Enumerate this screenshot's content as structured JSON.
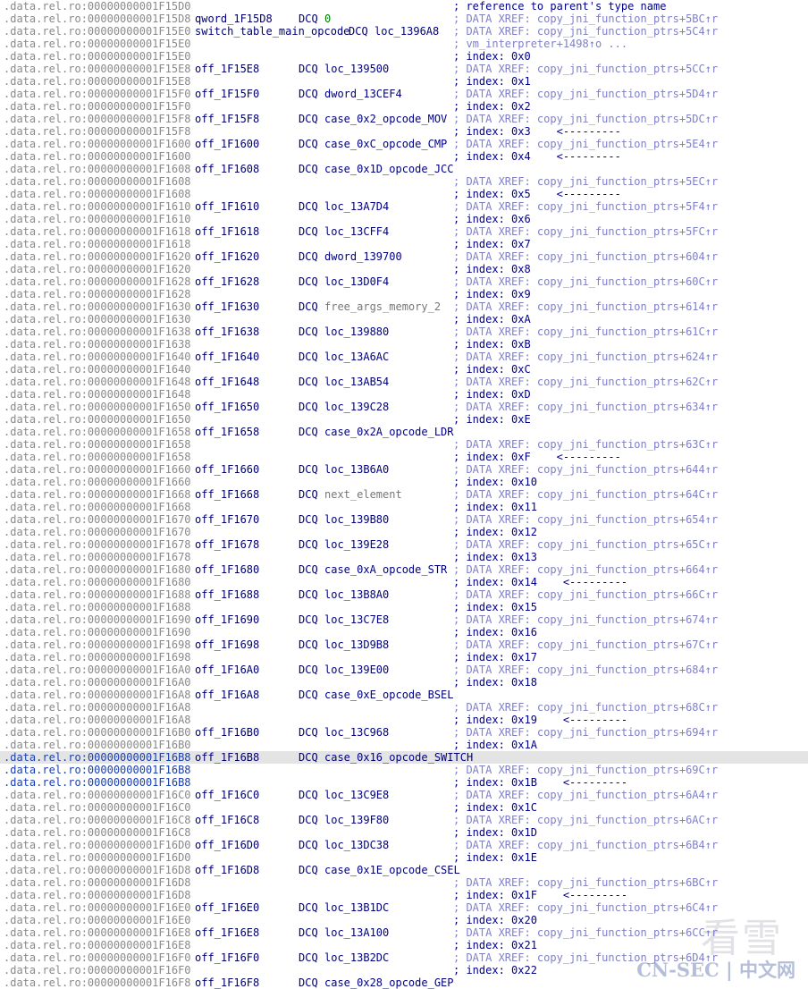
{
  "window": {
    "selected_line_index": 60,
    "colors": {
      "address": "#8a8a8a",
      "address_selected": "#1a3fae",
      "label": "#000070",
      "comment": "#00008b",
      "xref_comment": "#8080c8",
      "number": "#008000",
      "selection_bg": "#e4e4e4"
    }
  },
  "lines": [
    {
      "addr": ".data.rel.ro:00000000001F15D0",
      "label": "",
      "kw": "",
      "op": "",
      "cmt": "; reference to parent's type name",
      "ctype": "idx"
    },
    {
      "addr": ".data.rel.ro:00000000001F15D8",
      "label": "qword_1F15D8",
      "kw": "DCQ",
      "op": "0",
      "otype": "num",
      "cmt": "; DATA XREF: copy_jni_function_ptrs+5BC↑r",
      "ctype": "xref"
    },
    {
      "addr": ".data.rel.ro:00000000001F15E0",
      "label": "switch_table_main_opcode",
      "kw": "DCQ",
      "op": "loc_1396A8",
      "cmt": "; DATA XREF: copy_jni_function_ptrs+5C4↑r",
      "ctype": "xref",
      "kwpos": "inline"
    },
    {
      "addr": ".data.rel.ro:00000000001F15E0",
      "label": "",
      "kw": "",
      "op": "",
      "cmt": "; vm_interpreter+1498↑o ...",
      "ctype": "cont"
    },
    {
      "addr": ".data.rel.ro:00000000001F15E0",
      "label": "",
      "kw": "",
      "op": "",
      "cmt": "; index: 0x0",
      "ctype": "idx"
    },
    {
      "addr": ".data.rel.ro:00000000001F15E8",
      "label": "off_1F15E8",
      "kw": "DCQ",
      "op": "loc_139500",
      "cmt": "; DATA XREF: copy_jni_function_ptrs+5CC↑r",
      "ctype": "xref"
    },
    {
      "addr": ".data.rel.ro:00000000001F15E8",
      "label": "",
      "kw": "",
      "op": "",
      "cmt": "; index: 0x1",
      "ctype": "idx"
    },
    {
      "addr": ".data.rel.ro:00000000001F15F0",
      "label": "off_1F15F0",
      "kw": "DCQ",
      "op": "dword_13CEF4",
      "cmt": "; DATA XREF: copy_jni_function_ptrs+5D4↑r",
      "ctype": "xref"
    },
    {
      "addr": ".data.rel.ro:00000000001F15F0",
      "label": "",
      "kw": "",
      "op": "",
      "cmt": "; index: 0x2",
      "ctype": "idx"
    },
    {
      "addr": ".data.rel.ro:00000000001F15F8",
      "label": "off_1F15F8",
      "kw": "DCQ",
      "op": "case_0x2_opcode_MOV",
      "cmt": "; DATA XREF: copy_jni_function_ptrs+5DC↑r",
      "ctype": "xref"
    },
    {
      "addr": ".data.rel.ro:00000000001F15F8",
      "label": "",
      "kw": "",
      "op": "",
      "cmt": "; index: 0x3    <---------",
      "ctype": "idx"
    },
    {
      "addr": ".data.rel.ro:00000000001F1600",
      "label": "off_1F1600",
      "kw": "DCQ",
      "op": "case_0xC_opcode_CMP",
      "cmt": "; DATA XREF: copy_jni_function_ptrs+5E4↑r",
      "ctype": "xref"
    },
    {
      "addr": ".data.rel.ro:00000000001F1600",
      "label": "",
      "kw": "",
      "op": "",
      "cmt": "; index: 0x4    <---------",
      "ctype": "idx"
    },
    {
      "addr": ".data.rel.ro:00000000001F1608",
      "label": "off_1F1608",
      "kw": "DCQ",
      "op": "case_0x1D_opcode_JCC",
      "cmt": "",
      "ctype": "xref"
    },
    {
      "addr": ".data.rel.ro:00000000001F1608",
      "label": "",
      "kw": "",
      "op": "",
      "cmt": "; DATA XREF: copy_jni_function_ptrs+5EC↑r",
      "ctype": "xref"
    },
    {
      "addr": ".data.rel.ro:00000000001F1608",
      "label": "",
      "kw": "",
      "op": "",
      "cmt": "; index: 0x5    <---------",
      "ctype": "idx"
    },
    {
      "addr": ".data.rel.ro:00000000001F1610",
      "label": "off_1F1610",
      "kw": "DCQ",
      "op": "loc_13A7D4",
      "cmt": "; DATA XREF: copy_jni_function_ptrs+5F4↑r",
      "ctype": "xref"
    },
    {
      "addr": ".data.rel.ro:00000000001F1610",
      "label": "",
      "kw": "",
      "op": "",
      "cmt": "; index: 0x6",
      "ctype": "idx"
    },
    {
      "addr": ".data.rel.ro:00000000001F1618",
      "label": "off_1F1618",
      "kw": "DCQ",
      "op": "loc_13CFF4",
      "cmt": "; DATA XREF: copy_jni_function_ptrs+5FC↑r",
      "ctype": "xref"
    },
    {
      "addr": ".data.rel.ro:00000000001F1618",
      "label": "",
      "kw": "",
      "op": "",
      "cmt": "; index: 0x7",
      "ctype": "idx"
    },
    {
      "addr": ".data.rel.ro:00000000001F1620",
      "label": "off_1F1620",
      "kw": "DCQ",
      "op": "dword_139700",
      "cmt": "; DATA XREF: copy_jni_function_ptrs+604↑r",
      "ctype": "xref"
    },
    {
      "addr": ".data.rel.ro:00000000001F1620",
      "label": "",
      "kw": "",
      "op": "",
      "cmt": "; index: 0x8",
      "ctype": "idx"
    },
    {
      "addr": ".data.rel.ro:00000000001F1628",
      "label": "off_1F1628",
      "kw": "DCQ",
      "op": "loc_13D0F4",
      "cmt": "; DATA XREF: copy_jni_function_ptrs+60C↑r",
      "ctype": "xref"
    },
    {
      "addr": ".data.rel.ro:00000000001F1628",
      "label": "",
      "kw": "",
      "op": "",
      "cmt": "; index: 0x9",
      "ctype": "idx"
    },
    {
      "addr": ".data.rel.ro:00000000001F1630",
      "label": "off_1F1630",
      "kw": "DCQ",
      "op": "free_args_memory_2",
      "otype": "gray",
      "cmt": "; DATA XREF: copy_jni_function_ptrs+614↑r",
      "ctype": "xref"
    },
    {
      "addr": ".data.rel.ro:00000000001F1630",
      "label": "",
      "kw": "",
      "op": "",
      "cmt": "; index: 0xA",
      "ctype": "idx"
    },
    {
      "addr": ".data.rel.ro:00000000001F1638",
      "label": "off_1F1638",
      "kw": "DCQ",
      "op": "loc_139880",
      "cmt": "; DATA XREF: copy_jni_function_ptrs+61C↑r",
      "ctype": "xref"
    },
    {
      "addr": ".data.rel.ro:00000000001F1638",
      "label": "",
      "kw": "",
      "op": "",
      "cmt": "; index: 0xB",
      "ctype": "idx"
    },
    {
      "addr": ".data.rel.ro:00000000001F1640",
      "label": "off_1F1640",
      "kw": "DCQ",
      "op": "loc_13A6AC",
      "cmt": "; DATA XREF: copy_jni_function_ptrs+624↑r",
      "ctype": "xref"
    },
    {
      "addr": ".data.rel.ro:00000000001F1640",
      "label": "",
      "kw": "",
      "op": "",
      "cmt": "; index: 0xC",
      "ctype": "idx"
    },
    {
      "addr": ".data.rel.ro:00000000001F1648",
      "label": "off_1F1648",
      "kw": "DCQ",
      "op": "loc_13AB54",
      "cmt": "; DATA XREF: copy_jni_function_ptrs+62C↑r",
      "ctype": "xref"
    },
    {
      "addr": ".data.rel.ro:00000000001F1648",
      "label": "",
      "kw": "",
      "op": "",
      "cmt": "; index: 0xD",
      "ctype": "idx"
    },
    {
      "addr": ".data.rel.ro:00000000001F1650",
      "label": "off_1F1650",
      "kw": "DCQ",
      "op": "loc_139C28",
      "cmt": "; DATA XREF: copy_jni_function_ptrs+634↑r",
      "ctype": "xref"
    },
    {
      "addr": ".data.rel.ro:00000000001F1650",
      "label": "",
      "kw": "",
      "op": "",
      "cmt": "; index: 0xE",
      "ctype": "idx"
    },
    {
      "addr": ".data.rel.ro:00000000001F1658",
      "label": "off_1F1658",
      "kw": "DCQ",
      "op": "case_0x2A_opcode_LDR",
      "cmt": "",
      "ctype": "xref"
    },
    {
      "addr": ".data.rel.ro:00000000001F1658",
      "label": "",
      "kw": "",
      "op": "",
      "cmt": "; DATA XREF: copy_jni_function_ptrs+63C↑r",
      "ctype": "xref"
    },
    {
      "addr": ".data.rel.ro:00000000001F1658",
      "label": "",
      "kw": "",
      "op": "",
      "cmt": "; index: 0xF    <---------",
      "ctype": "idx"
    },
    {
      "addr": ".data.rel.ro:00000000001F1660",
      "label": "off_1F1660",
      "kw": "DCQ",
      "op": "loc_13B6A0",
      "cmt": "; DATA XREF: copy_jni_function_ptrs+644↑r",
      "ctype": "xref"
    },
    {
      "addr": ".data.rel.ro:00000000001F1660",
      "label": "",
      "kw": "",
      "op": "",
      "cmt": "; index: 0x10",
      "ctype": "idx"
    },
    {
      "addr": ".data.rel.ro:00000000001F1668",
      "label": "off_1F1668",
      "kw": "DCQ",
      "op": "next_element",
      "otype": "gray",
      "cmt": "; DATA XREF: copy_jni_function_ptrs+64C↑r",
      "ctype": "xref"
    },
    {
      "addr": ".data.rel.ro:00000000001F1668",
      "label": "",
      "kw": "",
      "op": "",
      "cmt": "; index: 0x11",
      "ctype": "idx"
    },
    {
      "addr": ".data.rel.ro:00000000001F1670",
      "label": "off_1F1670",
      "kw": "DCQ",
      "op": "loc_139B80",
      "cmt": "; DATA XREF: copy_jni_function_ptrs+654↑r",
      "ctype": "xref"
    },
    {
      "addr": ".data.rel.ro:00000000001F1670",
      "label": "",
      "kw": "",
      "op": "",
      "cmt": "; index: 0x12",
      "ctype": "idx"
    },
    {
      "addr": ".data.rel.ro:00000000001F1678",
      "label": "off_1F1678",
      "kw": "DCQ",
      "op": "loc_139E28",
      "cmt": "; DATA XREF: copy_jni_function_ptrs+65C↑r",
      "ctype": "xref"
    },
    {
      "addr": ".data.rel.ro:00000000001F1678",
      "label": "",
      "kw": "",
      "op": "",
      "cmt": "; index: 0x13",
      "ctype": "idx"
    },
    {
      "addr": ".data.rel.ro:00000000001F1680",
      "label": "off_1F1680",
      "kw": "DCQ",
      "op": "case_0xA_opcode_STR",
      "cmt": "; DATA XREF: copy_jni_function_ptrs+664↑r",
      "ctype": "xref"
    },
    {
      "addr": ".data.rel.ro:00000000001F1680",
      "label": "",
      "kw": "",
      "op": "",
      "cmt": "; index: 0x14    <---------",
      "ctype": "idx"
    },
    {
      "addr": ".data.rel.ro:00000000001F1688",
      "label": "off_1F1688",
      "kw": "DCQ",
      "op": "loc_13B8A0",
      "cmt": "; DATA XREF: copy_jni_function_ptrs+66C↑r",
      "ctype": "xref"
    },
    {
      "addr": ".data.rel.ro:00000000001F1688",
      "label": "",
      "kw": "",
      "op": "",
      "cmt": "; index: 0x15",
      "ctype": "idx"
    },
    {
      "addr": ".data.rel.ro:00000000001F1690",
      "label": "off_1F1690",
      "kw": "DCQ",
      "op": "loc_13C7E8",
      "cmt": "; DATA XREF: copy_jni_function_ptrs+674↑r",
      "ctype": "xref"
    },
    {
      "addr": ".data.rel.ro:00000000001F1690",
      "label": "",
      "kw": "",
      "op": "",
      "cmt": "; index: 0x16",
      "ctype": "idx"
    },
    {
      "addr": ".data.rel.ro:00000000001F1698",
      "label": "off_1F1698",
      "kw": "DCQ",
      "op": "loc_13D9B8",
      "cmt": "; DATA XREF: copy_jni_function_ptrs+67C↑r",
      "ctype": "xref"
    },
    {
      "addr": ".data.rel.ro:00000000001F1698",
      "label": "",
      "kw": "",
      "op": "",
      "cmt": "; index: 0x17",
      "ctype": "idx"
    },
    {
      "addr": ".data.rel.ro:00000000001F16A0",
      "label": "off_1F16A0",
      "kw": "DCQ",
      "op": "loc_139E00",
      "cmt": "; DATA XREF: copy_jni_function_ptrs+684↑r",
      "ctype": "xref"
    },
    {
      "addr": ".data.rel.ro:00000000001F16A0",
      "label": "",
      "kw": "",
      "op": "",
      "cmt": "; index: 0x18",
      "ctype": "idx"
    },
    {
      "addr": ".data.rel.ro:00000000001F16A8",
      "label": "off_1F16A8",
      "kw": "DCQ",
      "op": "case_0xE_opcode_BSEL",
      "cmt": "",
      "ctype": "xref"
    },
    {
      "addr": ".data.rel.ro:00000000001F16A8",
      "label": "",
      "kw": "",
      "op": "",
      "cmt": "; DATA XREF: copy_jni_function_ptrs+68C↑r",
      "ctype": "xref"
    },
    {
      "addr": ".data.rel.ro:00000000001F16A8",
      "label": "",
      "kw": "",
      "op": "",
      "cmt": "; index: 0x19    <---------",
      "ctype": "idx"
    },
    {
      "addr": ".data.rel.ro:00000000001F16B0",
      "label": "off_1F16B0",
      "kw": "DCQ",
      "op": "loc_13C968",
      "cmt": "; DATA XREF: copy_jni_function_ptrs+694↑r",
      "ctype": "xref"
    },
    {
      "addr": ".data.rel.ro:00000000001F16B0",
      "label": "",
      "kw": "",
      "op": "",
      "cmt": "; index: 0x1A",
      "ctype": "idx"
    },
    {
      "addr": ".data.rel.ro:00000000001F16B8",
      "label": "off_1F16B8",
      "kw": "DCQ",
      "op": "case_0x16_opcode_SWITCH",
      "cmt": "",
      "ctype": "xref",
      "selected": true
    },
    {
      "addr": ".data.rel.ro:00000000001F16B8",
      "label": "",
      "kw": "",
      "op": "",
      "cmt": "; DATA XREF: copy_jni_function_ptrs+69C↑r",
      "ctype": "xref",
      "hl": true
    },
    {
      "addr": ".data.rel.ro:00000000001F16B8",
      "label": "",
      "kw": "",
      "op": "",
      "cmt": "; index: 0x1B    <---------",
      "ctype": "idx",
      "hl": true
    },
    {
      "addr": ".data.rel.ro:00000000001F16C0",
      "label": "off_1F16C0",
      "kw": "DCQ",
      "op": "loc_13C9E8",
      "cmt": "; DATA XREF: copy_jni_function_ptrs+6A4↑r",
      "ctype": "xref"
    },
    {
      "addr": ".data.rel.ro:00000000001F16C0",
      "label": "",
      "kw": "",
      "op": "",
      "cmt": "; index: 0x1C",
      "ctype": "idx"
    },
    {
      "addr": ".data.rel.ro:00000000001F16C8",
      "label": "off_1F16C8",
      "kw": "DCQ",
      "op": "loc_139F80",
      "cmt": "; DATA XREF: copy_jni_function_ptrs+6AC↑r",
      "ctype": "xref"
    },
    {
      "addr": ".data.rel.ro:00000000001F16C8",
      "label": "",
      "kw": "",
      "op": "",
      "cmt": "; index: 0x1D",
      "ctype": "idx"
    },
    {
      "addr": ".data.rel.ro:00000000001F16D0",
      "label": "off_1F16D0",
      "kw": "DCQ",
      "op": "loc_13DC38",
      "cmt": "; DATA XREF: copy_jni_function_ptrs+6B4↑r",
      "ctype": "xref"
    },
    {
      "addr": ".data.rel.ro:00000000001F16D0",
      "label": "",
      "kw": "",
      "op": "",
      "cmt": "; index: 0x1E",
      "ctype": "idx"
    },
    {
      "addr": ".data.rel.ro:00000000001F16D8",
      "label": "off_1F16D8",
      "kw": "DCQ",
      "op": "case_0x1E_opcode_CSEL",
      "cmt": "",
      "ctype": "xref"
    },
    {
      "addr": ".data.rel.ro:00000000001F16D8",
      "label": "",
      "kw": "",
      "op": "",
      "cmt": "; DATA XREF: copy_jni_function_ptrs+6BC↑r",
      "ctype": "xref"
    },
    {
      "addr": ".data.rel.ro:00000000001F16D8",
      "label": "",
      "kw": "",
      "op": "",
      "cmt": "; index: 0x1F    <---------",
      "ctype": "idx"
    },
    {
      "addr": ".data.rel.ro:00000000001F16E0",
      "label": "off_1F16E0",
      "kw": "DCQ",
      "op": "loc_13B1DC",
      "cmt": "; DATA XREF: copy_jni_function_ptrs+6C4↑r",
      "ctype": "xref"
    },
    {
      "addr": ".data.rel.ro:00000000001F16E0",
      "label": "",
      "kw": "",
      "op": "",
      "cmt": "; index: 0x20",
      "ctype": "idx"
    },
    {
      "addr": ".data.rel.ro:00000000001F16E8",
      "label": "off_1F16E8",
      "kw": "DCQ",
      "op": "loc_13A100",
      "cmt": "; DATA XREF: copy_jni_function_ptrs+6CC↑r",
      "ctype": "xref"
    },
    {
      "addr": ".data.rel.ro:00000000001F16E8",
      "label": "",
      "kw": "",
      "op": "",
      "cmt": "; index: 0x21",
      "ctype": "idx"
    },
    {
      "addr": ".data.rel.ro:00000000001F16F0",
      "label": "off_1F16F0",
      "kw": "DCQ",
      "op": "loc_13B2DC",
      "cmt": "; DATA XREF: copy_jni_function_ptrs+6D4↑r",
      "ctype": "xref"
    },
    {
      "addr": ".data.rel.ro:00000000001F16F0",
      "label": "",
      "kw": "",
      "op": "",
      "cmt": "; index: 0x22",
      "ctype": "idx"
    },
    {
      "addr": ".data.rel.ro:00000000001F16F8",
      "label": "off_1F16F8",
      "kw": "DCQ",
      "op": "case_0x28_opcode_GEP",
      "cmt": "",
      "ctype": "xref"
    }
  ],
  "watermark": {
    "logo_text": "看雪",
    "brand_text": "CN-SEC | 中文网"
  }
}
